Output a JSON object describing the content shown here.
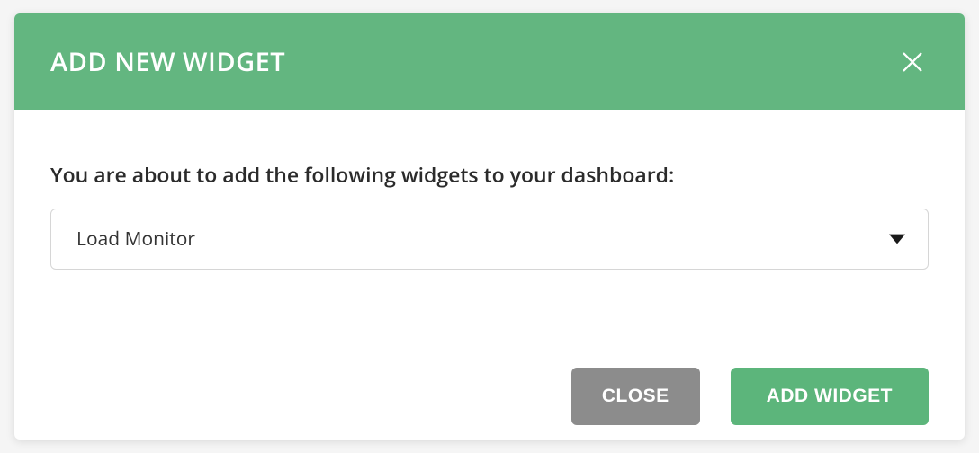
{
  "modal": {
    "title": "ADD NEW WIDGET",
    "body_text": "You are about to add the following widgets to your dashboard:",
    "select": {
      "value": "Load Monitor"
    },
    "footer": {
      "close_label": "CLOSE",
      "add_label": "ADD WIDGET"
    }
  }
}
